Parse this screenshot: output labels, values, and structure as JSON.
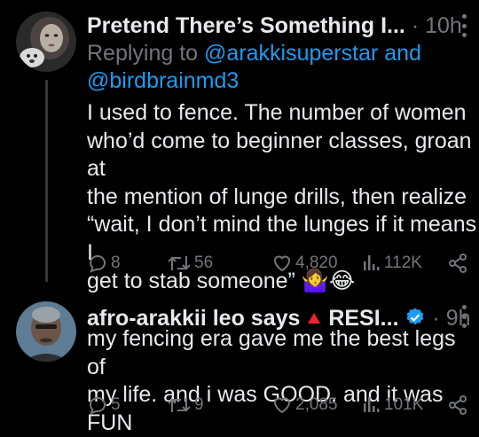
{
  "tweets": [
    {
      "display_name": "Pretend There’s Something I...",
      "separator": "·",
      "time": "10h",
      "replying_prefix": "Replying to",
      "replying_user1": "@arakkisuperstar",
      "replying_and": "and",
      "replying_user2": "@birdbrainmd3",
      "text_lines": [
        "I used to fence. The number of women",
        "who’d come to beginner classes, groan at",
        "the mention of lunge drills, then realize",
        "“wait, I don’t mind the lunges if it means I",
        "get to stab someone”"
      ],
      "emojis": "🤷‍♀️😂",
      "replies": "8",
      "reposts": "56",
      "likes": "4,820",
      "views": "112K"
    },
    {
      "display_name": "afro-arakkii leo says",
      "name_suffix": "RESI...",
      "separator": "·",
      "time": "9h",
      "text_lines": [
        "my fencing era gave me the best legs of",
        "my life. and i was GOOD. and it was FUN"
      ],
      "replies": "5",
      "reposts": "9",
      "likes": "2,085",
      "views": "101K"
    }
  ],
  "icons": {
    "reply": "reply-icon",
    "repost": "repost-icon",
    "like": "heart-icon",
    "views": "views-icon",
    "share": "share-icon",
    "verified": "verified-badge-icon",
    "warning": "red-triangle-icon",
    "more": "more-icon"
  },
  "colors": {
    "background": "#000000",
    "text": "#e7e9ea",
    "dim": "#71767b",
    "link": "#1d9bf0",
    "verified": "#1d9bf0",
    "triangle": "#f4212e"
  }
}
